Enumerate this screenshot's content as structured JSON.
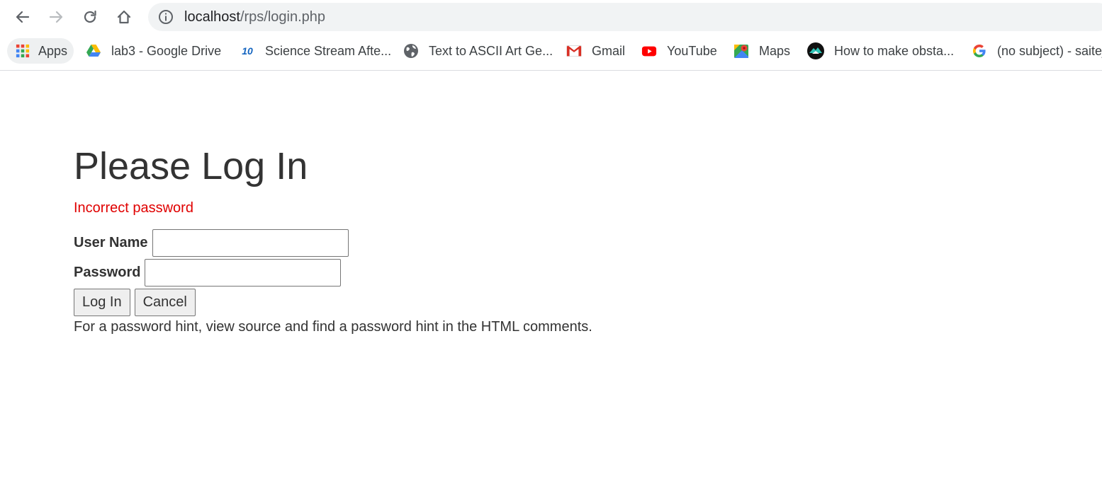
{
  "browser": {
    "url_host": "localhost",
    "url_path": "/rps/login.php"
  },
  "bookmarks": [
    {
      "label": "Apps",
      "icon": "apps-grid-icon"
    },
    {
      "label": "lab3 - Google Drive",
      "icon": "google-drive-icon"
    },
    {
      "label": "Science Stream Afte...",
      "icon": "ten-icon",
      "icon_text": "10"
    },
    {
      "label": "Text to ASCII Art Ge...",
      "icon": "globe-icon"
    },
    {
      "label": "Gmail",
      "icon": "gmail-icon"
    },
    {
      "label": "YouTube",
      "icon": "youtube-icon"
    },
    {
      "label": "Maps",
      "icon": "maps-icon"
    },
    {
      "label": "How to make obsta...",
      "icon": "mountain-icon"
    },
    {
      "label": "(no subject) - saitej",
      "icon": "google-icon"
    }
  ],
  "page": {
    "title": "Please Log In",
    "error": "Incorrect password",
    "username_label": "User Name",
    "username_value": "",
    "password_label": "Password",
    "password_value": "",
    "login_button": "Log In",
    "cancel_button": "Cancel",
    "hint": "For a password hint, view source and find a password hint in the HTML comments."
  },
  "colors": {
    "error": "#e00000",
    "text": "#333333",
    "omnibox": "#f1f3f4"
  }
}
